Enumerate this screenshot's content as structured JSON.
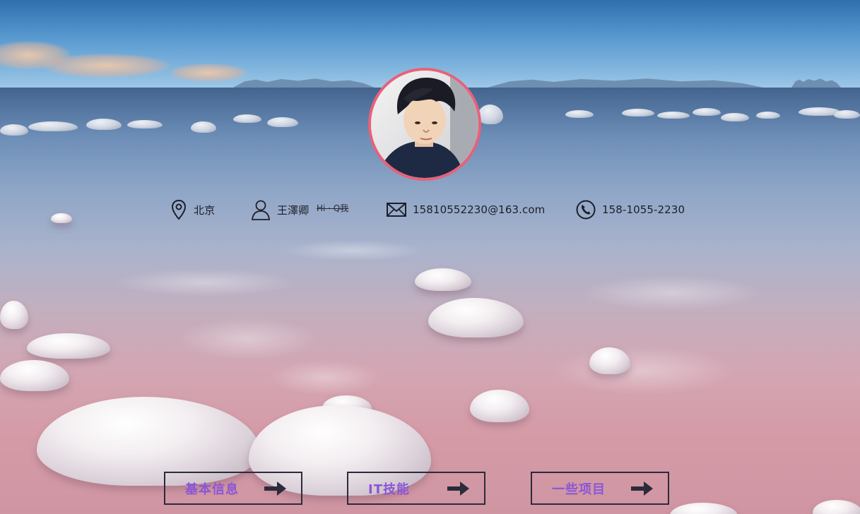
{
  "contact": {
    "location": "北京",
    "name": "王澤卿",
    "tagline": "Hi · Q我",
    "email": "15810552230@163.com",
    "phone": "158-1055-2230"
  },
  "nav": [
    {
      "label": "基本信息"
    },
    {
      "label": "IT技能"
    },
    {
      "label": "一些项目"
    }
  ],
  "colors": {
    "avatar_border": "#e8617a",
    "button_text": "#8a56d6",
    "button_border": "#2b2b3a",
    "contact_text": "#1e1e28"
  },
  "icons": {
    "location": "map-pin-icon",
    "name": "user-icon",
    "email": "envelope-icon",
    "phone": "phone-icon",
    "nav_arrow": "arrow-right-icon"
  }
}
